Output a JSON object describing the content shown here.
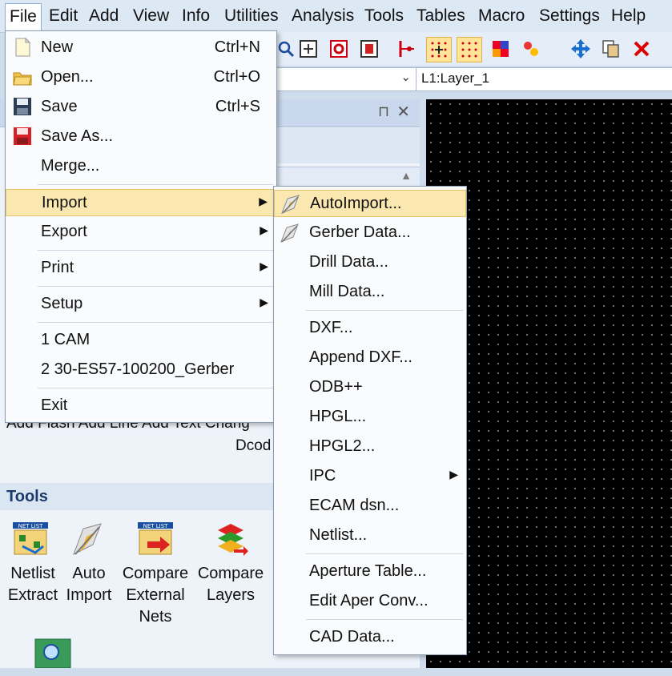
{
  "menubar": {
    "items": [
      "File",
      "Edit",
      "Add",
      "View",
      "Info",
      "Utilities",
      "Analysis",
      "Tools",
      "Tables",
      "Macro",
      "Settings",
      "Help"
    ]
  },
  "toolbar": {
    "icons": [
      "zoom-icon",
      "zoom-box-icon",
      "zoom-fit-icon",
      "zoom-page-icon",
      "crosshair-icon",
      "grid-snap-icon",
      "grid-dots-icon",
      "color-icon",
      "layers-icon",
      "move-icon",
      "copy-icon",
      "delete-icon"
    ]
  },
  "layer_combo": {
    "value": "L1:Layer_1"
  },
  "panel": {
    "pin": "⊓",
    "close": "✕"
  },
  "background_labels": {
    "add_row": "Add Flash Add Line Add Text Chang",
    "dcode": "Dcod"
  },
  "tools_panel": {
    "title": "Tools",
    "items": [
      {
        "line1": "Netlist",
        "line2": "Extract",
        "line3": ""
      },
      {
        "line1": "Auto",
        "line2": "Import",
        "line3": ""
      },
      {
        "line1": "Compare",
        "line2": "External",
        "line3": "Nets"
      },
      {
        "line1": "Compare",
        "line2": "Layers",
        "line3": ""
      }
    ]
  },
  "file_menu": {
    "new": {
      "label": "New",
      "shortcut": "Ctrl+N"
    },
    "open": {
      "label": "Open...",
      "shortcut": "Ctrl+O"
    },
    "save": {
      "label": "Save",
      "shortcut": "Ctrl+S"
    },
    "save_as": {
      "label": "Save As..."
    },
    "merge": {
      "label": "Merge..."
    },
    "import": {
      "label": "Import"
    },
    "export": {
      "label": "Export"
    },
    "print": {
      "label": "Print"
    },
    "setup": {
      "label": "Setup"
    },
    "recent1": {
      "label": "1 CAM"
    },
    "recent2": {
      "label": "2 30-ES57-100200_Gerber"
    },
    "exit": {
      "label": "Exit"
    }
  },
  "import_menu": {
    "autoimport": "AutoImport...",
    "gerber": "Gerber Data...",
    "drill": "Drill Data...",
    "mill": "Mill Data...",
    "dxf": "DXF...",
    "append_dxf": "Append DXF...",
    "odb": "ODB++",
    "hpgl": "HPGL...",
    "hpgl2": "HPGL2...",
    "ipc": "IPC",
    "ecam": "ECAM dsn...",
    "netlist": "Netlist...",
    "aperture": "Aperture Table...",
    "edit_aper": "Edit Aper Conv...",
    "cad": "CAD Data..."
  },
  "colors": {
    "highlight": "#fbe7b0",
    "highlight_border": "#e5c36a",
    "canvas": "#000000"
  }
}
